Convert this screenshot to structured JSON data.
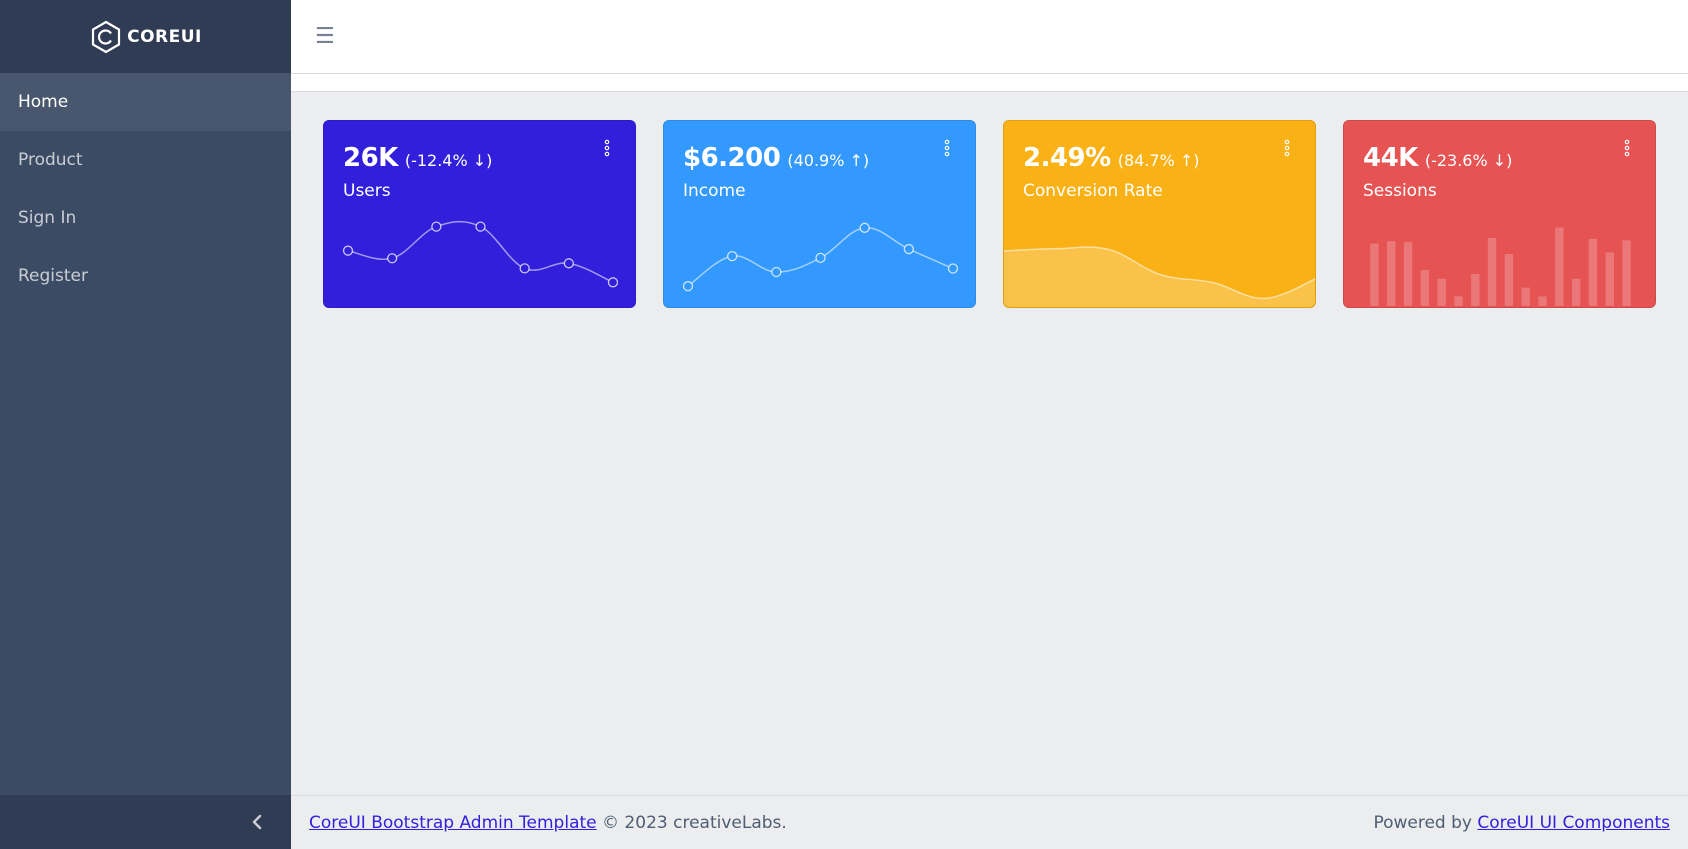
{
  "brand": {
    "name": "COREUI"
  },
  "sidebar": {
    "items": [
      {
        "label": "Home",
        "active": true
      },
      {
        "label": "Product",
        "active": false
      },
      {
        "label": "Sign In",
        "active": false
      },
      {
        "label": "Register",
        "active": false
      }
    ],
    "toggler_icon": "chevron-left-icon"
  },
  "header": {
    "toggler_icon": "hamburger-icon",
    "toggler_glyph": "☰"
  },
  "widgets": [
    {
      "value": "26K",
      "delta": "(-12.4% ↓)",
      "title": "Users",
      "color": "#321fdb",
      "chart_type": "line"
    },
    {
      "value": "$6.200",
      "delta": "(40.9% ↑)",
      "title": "Income",
      "color": "#3399ff",
      "chart_type": "line"
    },
    {
      "value": "2.49%",
      "delta": "(84.7% ↑)",
      "title": "Conversion Rate",
      "color": "#f9b115",
      "chart_type": "area"
    },
    {
      "value": "44K",
      "delta": "(-23.6% ↓)",
      "title": "Sessions",
      "color": "#e55353",
      "chart_type": "bar"
    }
  ],
  "chart_data": [
    {
      "type": "line",
      "values": [
        65,
        59,
        84,
        84,
        51,
        55,
        40
      ],
      "ylim": [
        30,
        90
      ]
    },
    {
      "type": "line",
      "values": [
        1,
        18,
        9,
        17,
        34,
        22,
        11
      ],
      "ylim": [
        -4,
        39
      ]
    },
    {
      "type": "area",
      "values": [
        78,
        81,
        80,
        45,
        34,
        12,
        40
      ],
      "ylim": [
        0,
        100
      ]
    },
    {
      "type": "bar",
      "values": [
        78,
        81,
        80,
        45,
        34,
        12,
        40,
        85,
        65,
        23,
        12,
        98,
        34,
        84,
        67,
        82
      ],
      "ylim": [
        0,
        100
      ]
    }
  ],
  "footer": {
    "left_link": "CoreUI Bootstrap Admin Template",
    "left_text": "© 2023 creativeLabs.",
    "right_text": "Powered by",
    "right_link": "CoreUI UI Components"
  }
}
